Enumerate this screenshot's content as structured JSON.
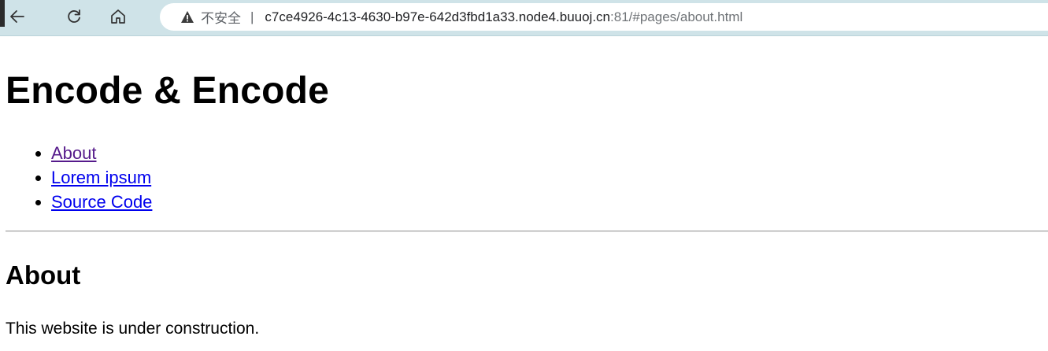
{
  "browser": {
    "security_label": "不安全",
    "separator": "|",
    "url_host": "c7ce4926-4c13-4630-b97e-642d3fbd1a33.node4.buuoj.cn",
    "url_rest": ":81/#pages/about.html",
    "toolbar_color": "#cfe3e8"
  },
  "page": {
    "title": "Encode & Encode",
    "nav": [
      {
        "label": "About",
        "visited": true
      },
      {
        "label": "Lorem ipsum",
        "visited": false
      },
      {
        "label": "Source Code",
        "visited": false
      }
    ],
    "section_heading": "About",
    "body_text": "This website is under construction.",
    "link_color": "#0000ee",
    "visited_link_color": "#551a8b"
  }
}
